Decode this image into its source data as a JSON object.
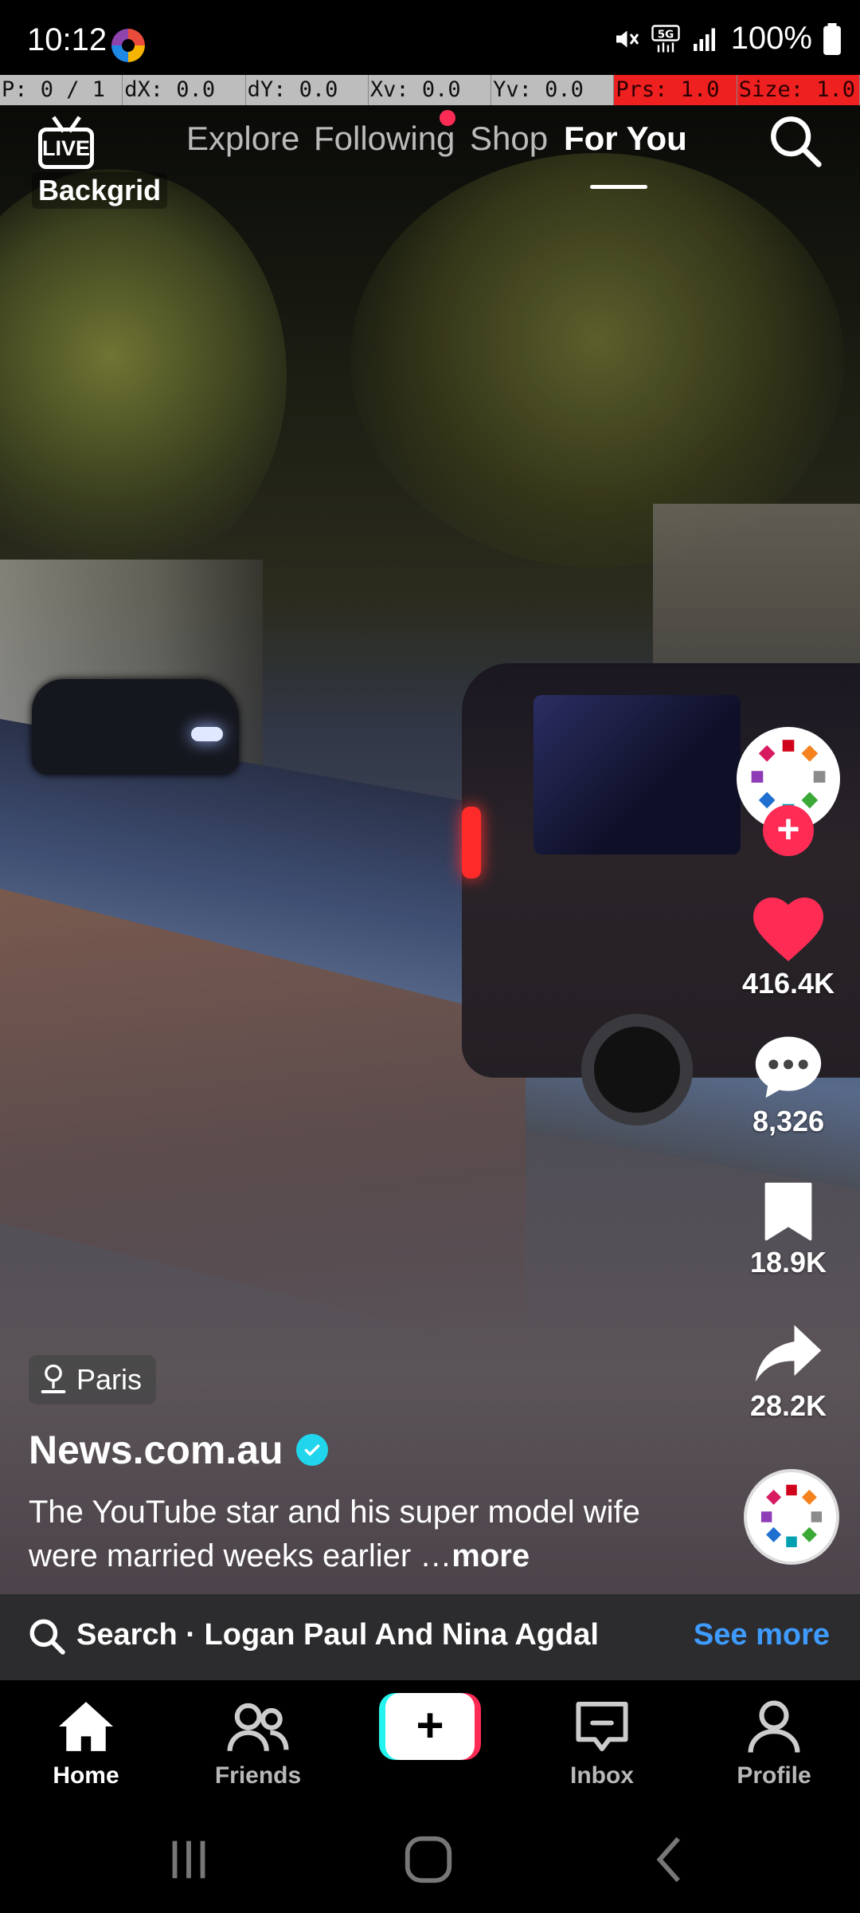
{
  "status_bar": {
    "time": "10:12",
    "battery": "100%",
    "icons": [
      "app-logo-icon",
      "mute-icon",
      "5g-icon",
      "signal-icon",
      "battery-icon"
    ]
  },
  "debug_overlay": {
    "cells": [
      "P: 0 / 1",
      "dX: 0.0",
      "dY: 0.0",
      "Xv: 0.0",
      "Yv: 0.0",
      "Prs: 1.0",
      "Size: 1.0"
    ]
  },
  "top_nav": {
    "live_badge": "LIVE",
    "live_label": "Backgrid",
    "tabs": [
      {
        "label": "Explore",
        "active": false
      },
      {
        "label": "Following",
        "active": false,
        "has_dot": true
      },
      {
        "label": "Shop",
        "active": false
      },
      {
        "label": "For You",
        "active": true
      }
    ]
  },
  "right_rail": {
    "likes": "416.4K",
    "comments": "8,326",
    "saves": "18.9K",
    "shares": "28.2K"
  },
  "post": {
    "location": "Paris",
    "author": "News.com.au",
    "caption": "The YouTube star and his super model wife were married weeks earlier …",
    "caption_more": "more"
  },
  "search_suggestion": {
    "text": "Search · Logan Paul And Nina Agdal",
    "action": "See more"
  },
  "bottom_nav": {
    "home": "Home",
    "friends": "Friends",
    "create": "+",
    "inbox": "Inbox",
    "profile": "Profile"
  },
  "colors": {
    "accent_red": "#fe2c55",
    "accent_cyan": "#25f4ee",
    "link_blue": "#3e9bff",
    "verified": "#20d5ec"
  }
}
